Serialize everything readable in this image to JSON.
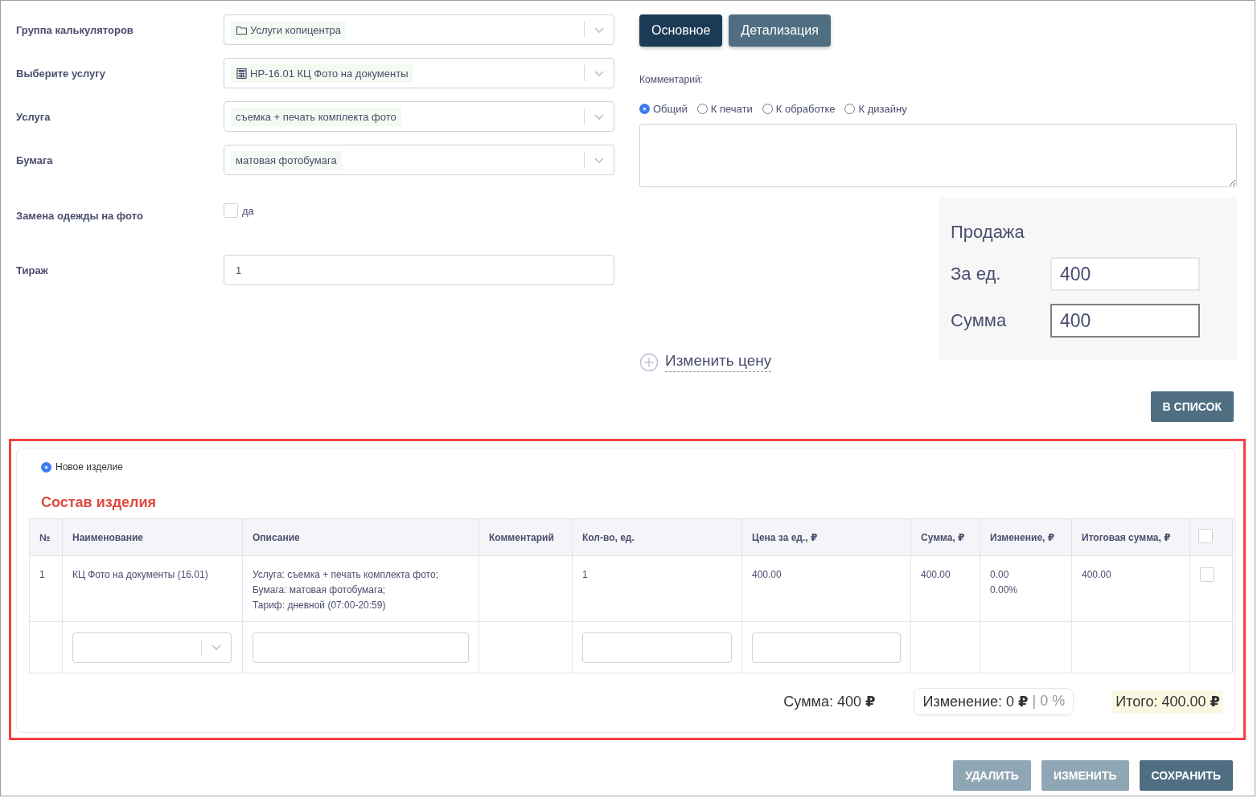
{
  "form": {
    "fields": [
      {
        "kind": "select",
        "label": "Группа калькуляторов",
        "value": "Услуги копицентра"
      },
      {
        "kind": "select",
        "label": "Выберите услугу",
        "value": "НР-16.01 КЦ Фото на документы"
      },
      {
        "kind": "select",
        "label": "Услуга",
        "value": "съемка + печать комплекта фото"
      },
      {
        "kind": "select",
        "label": "Бумага",
        "value": "матовая фотобумага"
      },
      {
        "kind": "checkbox",
        "label": "Замена одежды на фото",
        "option": "да",
        "checked": false
      },
      {
        "kind": "input",
        "label": "Тираж",
        "value": "1"
      }
    ]
  },
  "tabs": [
    {
      "label": "Основное",
      "selected": true
    },
    {
      "label": "Детализация",
      "selected": false
    }
  ],
  "comment": {
    "label": "Комментарий:",
    "options": [
      {
        "label": "Общий",
        "selected": true
      },
      {
        "label": "К печати",
        "selected": false
      },
      {
        "label": "К обработке",
        "selected": false
      },
      {
        "label": "К дизайну",
        "selected": false
      }
    ]
  },
  "sale": {
    "title": "Продажа",
    "rows": [
      {
        "label": "За ед.",
        "value": "400",
        "focused": false
      },
      {
        "label": "Сумма",
        "value": "400",
        "focused": true
      }
    ]
  },
  "change_price": "Изменить цену",
  "to_list_button": "В СПИСОК",
  "product": {
    "new_item": {
      "label": "Новое изделие",
      "selected": true
    },
    "title": "Состав изделия",
    "table": {
      "columns": [
        "№",
        "Наименование",
        "Описание",
        "Комментарий",
        "Кол-во, ед.",
        "Цена за ед., ₽",
        "Сумма, ₽",
        "Изменение, ₽",
        "Итоговая сумма, ₽"
      ],
      "select_all_checked": false,
      "rows": [
        {
          "number": "1",
          "name": "КЦ Фото на документы (16.01)",
          "description": [
            "Услуга: съемка + печать комплекта фото;",
            "Бумага: матовая фотобумага;",
            "Тариф: дневной (07:00-20:59)"
          ],
          "quantity": "1",
          "price": "400.00",
          "sum": "400.00",
          "change": [
            "0.00",
            "0.00%"
          ],
          "total": "400.00",
          "checked": false
        }
      ]
    },
    "totals": {
      "sum": "Сумма: 400 **₽**",
      "change": "Изменение: 0 **₽**",
      "change_percent": "| 0 %",
      "total": "Итого: 400.00 **₽**"
    }
  },
  "actions": [
    {
      "label": "УДАЛИТЬ",
      "disabled": true
    },
    {
      "label": "ИЗМЕНИТЬ",
      "disabled": true
    },
    {
      "label": "СОХРАНИТЬ",
      "disabled": false
    }
  ]
}
